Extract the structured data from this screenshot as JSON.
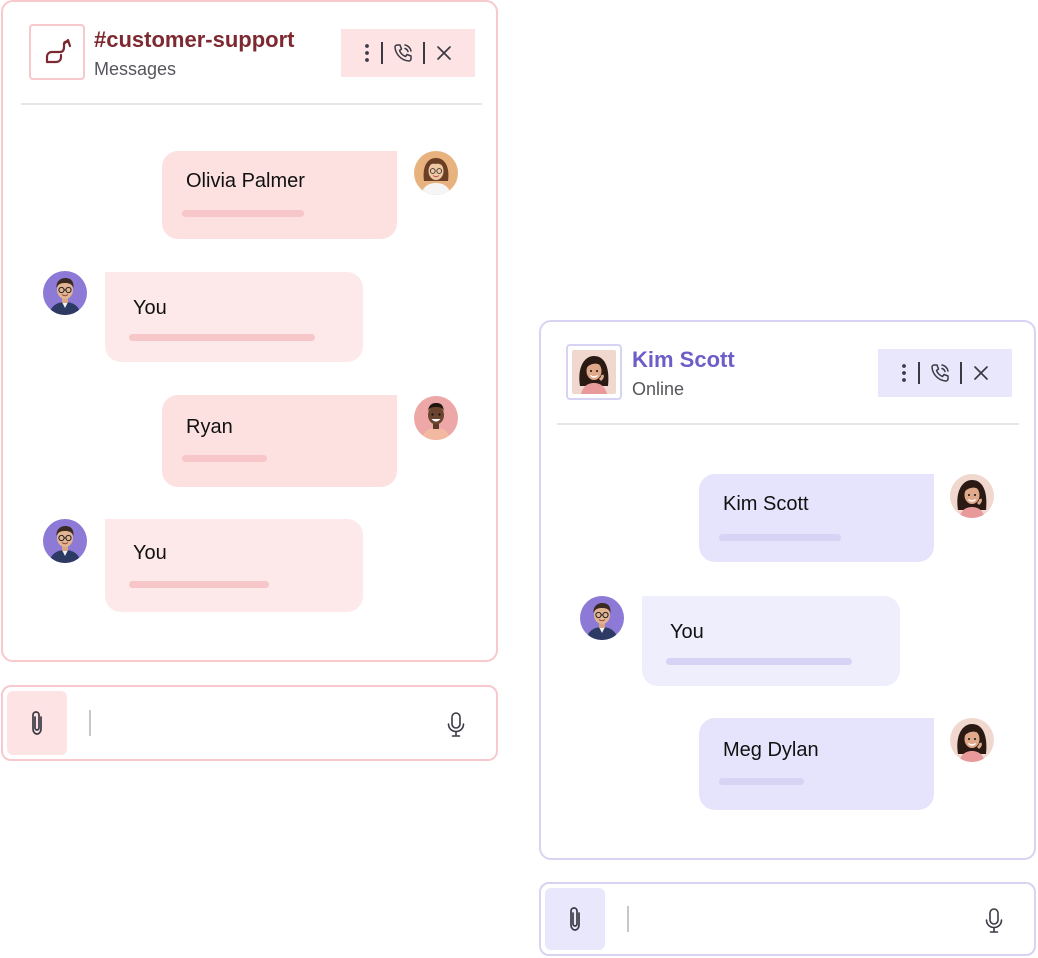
{
  "colors": {
    "red_border": "#f7c9cd",
    "red_bubble_incoming": "#fde1e1",
    "red_bubble_outgoing": "#fde9e9",
    "red_line": "#f6c6c8",
    "red_title": "#7d2931",
    "red_actions_bg": "#fde3e3",
    "purple_border": "#d7d3f3",
    "purple_bubble_incoming": "#e6e4fc",
    "purple_bubble_outgoing": "#eeeefd",
    "purple_line": "#d6d3f5",
    "purple_title": "#6d5ec7",
    "purple_actions_bg": "#e9e7fc"
  },
  "channel_chat": {
    "header_icon": "channel-icon",
    "title": "#customer-support",
    "subtitle": "Messages",
    "actions": [
      "more-vertical-icon",
      "phone-call-icon",
      "close-icon"
    ],
    "messages": [
      {
        "name": "Olivia Palmer",
        "avatar": "avatar-olivia-palmer"
      },
      {
        "name": "You",
        "avatar": "avatar-you"
      },
      {
        "name": "Ryan",
        "avatar": "avatar-ryan"
      },
      {
        "name": "You",
        "avatar": "avatar-you"
      }
    ],
    "composer": {
      "attach_icon": "paperclip-icon",
      "mic_icon": "microphone-icon",
      "value": ""
    }
  },
  "direct_chat": {
    "header_avatar": "avatar-kim-scott",
    "title": "Kim Scott",
    "subtitle": "Online",
    "actions": [
      "more-vertical-icon",
      "phone-call-icon",
      "close-icon"
    ],
    "messages": [
      {
        "name": "Kim Scott",
        "avatar": "avatar-kim-scott"
      },
      {
        "name": "You",
        "avatar": "avatar-you"
      },
      {
        "name": "Meg Dylan",
        "avatar": "avatar-meg-dylan"
      }
    ],
    "composer": {
      "attach_icon": "paperclip-icon",
      "mic_icon": "microphone-icon",
      "value": ""
    }
  }
}
